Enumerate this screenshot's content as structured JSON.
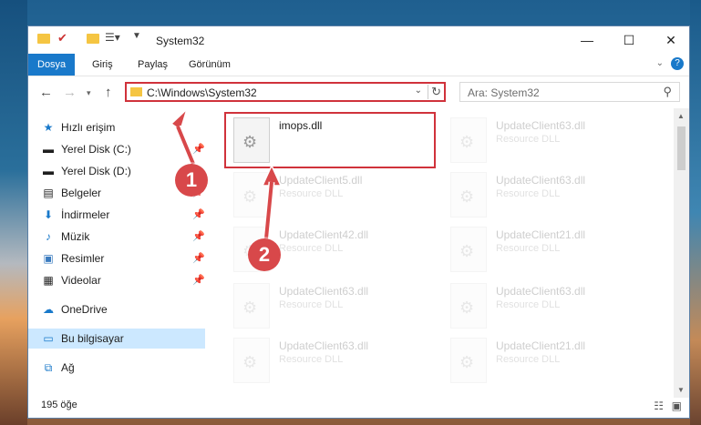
{
  "window": {
    "title": "System32",
    "controls": {
      "minimize": "—",
      "maximize": "☐",
      "close": "✕"
    }
  },
  "ribbon": {
    "tabs": [
      "Dosya",
      "Giriş",
      "Paylaş",
      "Görünüm"
    ],
    "active_tab": "Dosya"
  },
  "navbar": {
    "address": "C:\\Windows\\System32",
    "search_placeholder": "Ara: System32"
  },
  "sidebar": {
    "items": [
      {
        "label": "Hızlı erişim",
        "icon": "star-icon",
        "pinned": false
      },
      {
        "label": "Yerel Disk (C:)",
        "icon": "drive-icon",
        "pinned": true
      },
      {
        "label": "Yerel Disk (D:)",
        "icon": "drive-icon",
        "pinned": false
      },
      {
        "label": "Belgeler",
        "icon": "documents-icon",
        "pinned": true
      },
      {
        "label": "İndirmeler",
        "icon": "download-icon",
        "pinned": true
      },
      {
        "label": "Müzik",
        "icon": "music-icon",
        "pinned": true
      },
      {
        "label": "Resimler",
        "icon": "pictures-icon",
        "pinned": true
      },
      {
        "label": "Videolar",
        "icon": "videos-icon",
        "pinned": true
      },
      {
        "label": "OneDrive",
        "icon": "onedrive-icon",
        "pinned": false
      },
      {
        "label": "Bu bilgisayar",
        "icon": "computer-icon",
        "pinned": false,
        "selected": true
      },
      {
        "label": "Ağ",
        "icon": "network-icon",
        "pinned": false
      }
    ]
  },
  "files": [
    {
      "name": "imops.dll",
      "type": "",
      "highlighted": true
    },
    {
      "name": "UpdateClient63.dll",
      "type": "Resource DLL"
    },
    {
      "name": "UpdateClient5.dll",
      "type": "Resource DLL"
    },
    {
      "name": "UpdateClient63.dll",
      "type": "Resource DLL"
    },
    {
      "name": "UpdateClient42.dll",
      "type": "Resource DLL"
    },
    {
      "name": "UpdateClient21.dll",
      "type": "Resource DLL"
    },
    {
      "name": "UpdateClient63.dll",
      "type": "Resource DLL"
    },
    {
      "name": "UpdateClient63.dll",
      "type": "Resource DLL"
    },
    {
      "name": "UpdateClient63.dll",
      "type": "Resource DLL"
    },
    {
      "name": "UpdateClient21.dll",
      "type": "Resource DLL"
    }
  ],
  "status": {
    "count": "195 öğe"
  },
  "annotations": {
    "badge_1": "1",
    "badge_2": "2"
  },
  "colors": {
    "accent": "#1979ca",
    "highlight": "#d0323b",
    "badge": "#d8484a"
  }
}
